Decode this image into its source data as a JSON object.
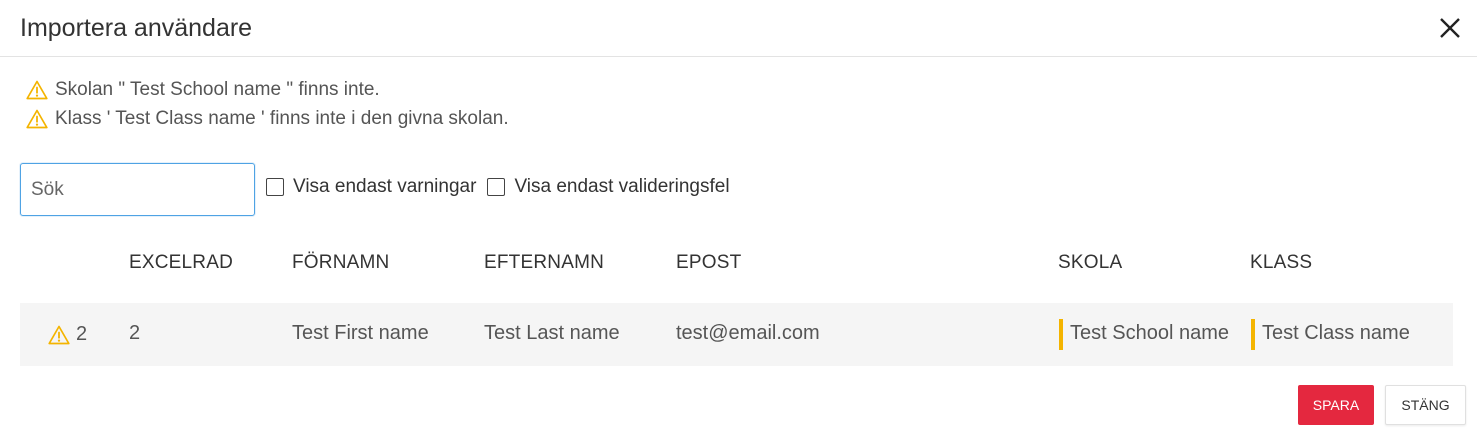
{
  "dialog": {
    "title": "Importera användare",
    "close_icon": "close-icon"
  },
  "warnings": [
    {
      "icon": "warning-icon",
      "text": "Skolan \" Test School name \" finns inte."
    },
    {
      "icon": "warning-icon",
      "text": "Klass ' Test Class name ' finns inte i den givna skolan."
    }
  ],
  "search": {
    "placeholder": "Sök",
    "value": ""
  },
  "filters": {
    "warnings_only": {
      "label": "Visa endast varningar",
      "checked": false
    },
    "validation_only": {
      "label": "Visa endast valideringsfel",
      "checked": false
    }
  },
  "table": {
    "columns": [
      "EXCELRAD",
      "FÖRNAMN",
      "EFTERNAMN",
      "EPOST",
      "SKOLA",
      "KLASS"
    ],
    "rows": [
      {
        "status_icon": "warning-icon",
        "status_count": "2",
        "excelrad": "2",
        "fornamn": "Test First name",
        "efternamn": "Test Last name",
        "epost": "test@email.com",
        "skola": "Test School name",
        "klass": "Test Class name"
      }
    ]
  },
  "buttons": {
    "save": "SPARA",
    "close": "STÄNG"
  },
  "colors": {
    "warning": "#f4b400",
    "primary": "#e4283f",
    "focus": "#4fa3e4"
  }
}
